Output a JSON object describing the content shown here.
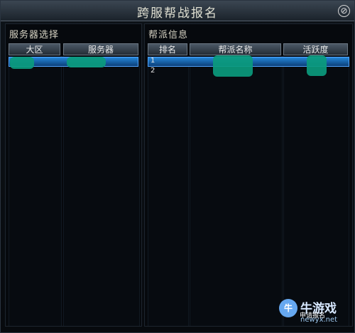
{
  "window": {
    "title": "跨服帮战报名",
    "close_icon": "⊘"
  },
  "left_panel": {
    "title": "服务器选择",
    "headers": [
      "大区",
      "服务器"
    ]
  },
  "right_panel": {
    "title": "帮派信息",
    "headers": [
      "排名",
      "帮派名称",
      "活跃度"
    ],
    "rows": [
      {
        "rank": "1"
      },
      {
        "rank": "2"
      }
    ]
  },
  "footer": {
    "apply_button": "申请报名"
  },
  "watermark": {
    "logo": "牛",
    "line1": "牛游戏",
    "line2": "newyx.net"
  }
}
